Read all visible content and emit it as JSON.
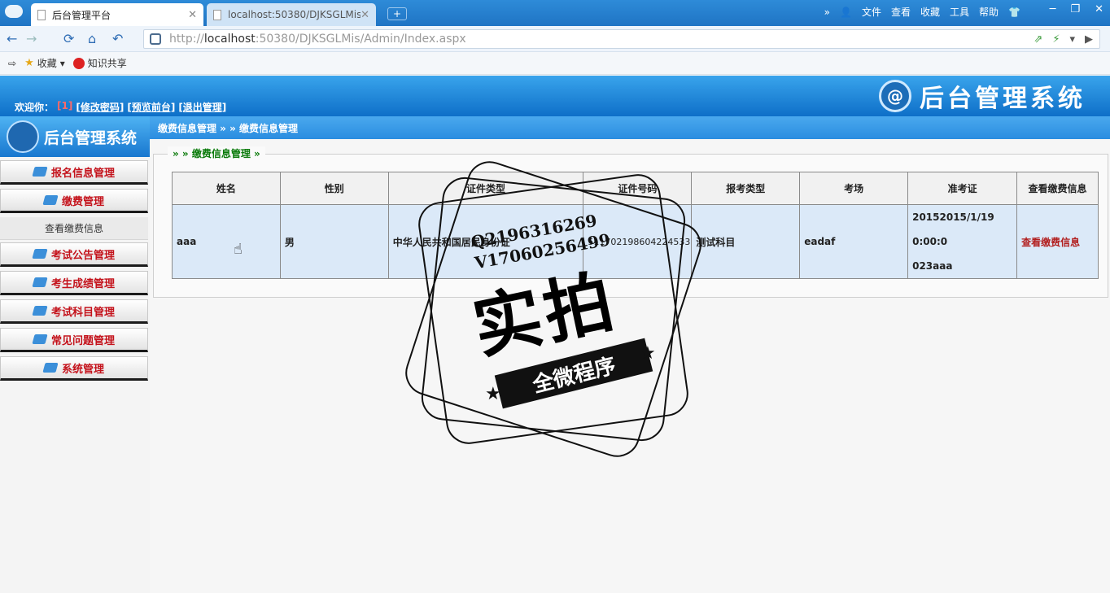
{
  "browser": {
    "tabs": [
      {
        "title": "后台管理平台",
        "active": true
      },
      {
        "title": "localhost:50380/DJKSGLMis",
        "active": false
      }
    ],
    "menu": [
      "文件",
      "查看",
      "收藏",
      "工具",
      "帮助"
    ],
    "url_prefix": "http://",
    "url_host": "localhost",
    "url_rest": ":50380/DJKSGLMis/Admin/Index.aspx",
    "favorites": [
      "收藏",
      "知识共享"
    ]
  },
  "header": {
    "welcome": "欢迎你：",
    "user_num": "[1]",
    "links": [
      "[修改密码]",
      "[预览前台]",
      "[退出管理]"
    ],
    "brand": "后台管理系统"
  },
  "sidebar": {
    "title": "后台管理系统",
    "items": [
      "报名信息管理",
      "缴费管理",
      "考试公告管理",
      "考生成绩管理",
      "考试科目管理",
      "常见问题管理",
      "系统管理"
    ],
    "submenu": "查看缴费信息"
  },
  "main": {
    "breadcrumb": "缴费信息管理 » » 缴费信息管理",
    "legend": "» » 缴费信息管理 »",
    "columns": [
      "姓名",
      "性别",
      "证件类型",
      "证件号码",
      "报考类型",
      "考场",
      "准考证",
      "查看缴费信息"
    ],
    "row": {
      "name": "aaa",
      "gender": "男",
      "id_type": "中华人民共和国居民身份证",
      "id_no": "511702198604224533",
      "exam_type": "测试科目",
      "room": "eadaf",
      "ticket_line1": "20152015/1/19 0:00:0",
      "ticket_line2": "023aaa",
      "action": "查看缴费信息"
    }
  },
  "watermark": {
    "qq": "Q2196316269",
    "v": "V17060256499",
    "big": "实拍",
    "ribbon": "全微程序"
  }
}
